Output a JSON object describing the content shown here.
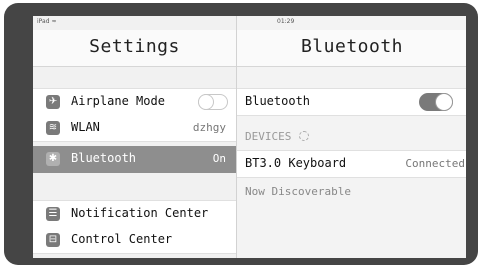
{
  "status_bar": {
    "left": "iPad",
    "wifi_icon": "wifi-icon",
    "time": "01:29"
  },
  "settings_panel": {
    "title": "Settings",
    "items": [
      {
        "label": "Airplane Mode",
        "icon": "airplane-icon",
        "toggle": "off"
      },
      {
        "label": "WLAN",
        "icon": "wifi-icon",
        "value": "dzhgy"
      },
      {
        "label": "Bluetooth",
        "icon": "bluetooth-icon",
        "value": "On",
        "selected": true
      },
      {
        "label": "Notification Center",
        "icon": "notification-icon"
      },
      {
        "label": "Control Center",
        "icon": "control-center-icon"
      }
    ]
  },
  "bluetooth_panel": {
    "title": "Bluetooth",
    "toggle_label": "Bluetooth",
    "toggle_state": "on",
    "devices_header": "DEVICES",
    "device": {
      "name": "BT3.0 Keyboard",
      "status": "Connected"
    },
    "discoverable_note": "Now Discoverable"
  },
  "colors": {
    "bezel": "#454545",
    "selected_row": "#8e8e8e",
    "toggle_on": "#7a7a7a"
  }
}
